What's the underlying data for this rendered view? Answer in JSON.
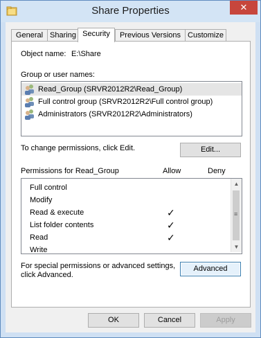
{
  "window": {
    "title": "Share Properties",
    "close_glyph": "✕"
  },
  "tabs": [
    {
      "label": "General"
    },
    {
      "label": "Sharing"
    },
    {
      "label": "Security"
    },
    {
      "label": "Previous Versions"
    },
    {
      "label": "Customize"
    }
  ],
  "security": {
    "object_name_label": "Object name:",
    "object_name_value": "E:\\Share",
    "group_label": "Group or user names:",
    "users": [
      {
        "label": "Read_Group (SRVR2012R2\\Read_Group)",
        "icon": "group-icon"
      },
      {
        "label": "Full control group (SRVR2012R2\\Full control group)",
        "icon": "group-icon"
      },
      {
        "label": "Administrators (SRVR2012R2\\Administrators)",
        "icon": "group-icon"
      }
    ],
    "change_text": "To change permissions, click Edit.",
    "edit_button": "Edit...",
    "permissions_header": "Permissions for Read_Group",
    "allow_header": "Allow",
    "deny_header": "Deny",
    "permissions": [
      {
        "name": "Full control",
        "allow": false
      },
      {
        "name": "Modify",
        "allow": false
      },
      {
        "name": "Read & execute",
        "allow": true
      },
      {
        "name": "List folder contents",
        "allow": true
      },
      {
        "name": "Read",
        "allow": true
      },
      {
        "name": "Write",
        "allow": false
      }
    ],
    "advanced_text_1": "For special permissions or advanced settings,",
    "advanced_text_2": "click Advanced.",
    "advanced_button": "Advanced"
  },
  "footer": {
    "ok": "OK",
    "cancel": "Cancel",
    "apply": "Apply"
  },
  "check_glyph": "✓",
  "colors": {
    "titlebar": "#d3e4f5",
    "close": "#c7463c",
    "window_border": "#5f8bbf"
  }
}
